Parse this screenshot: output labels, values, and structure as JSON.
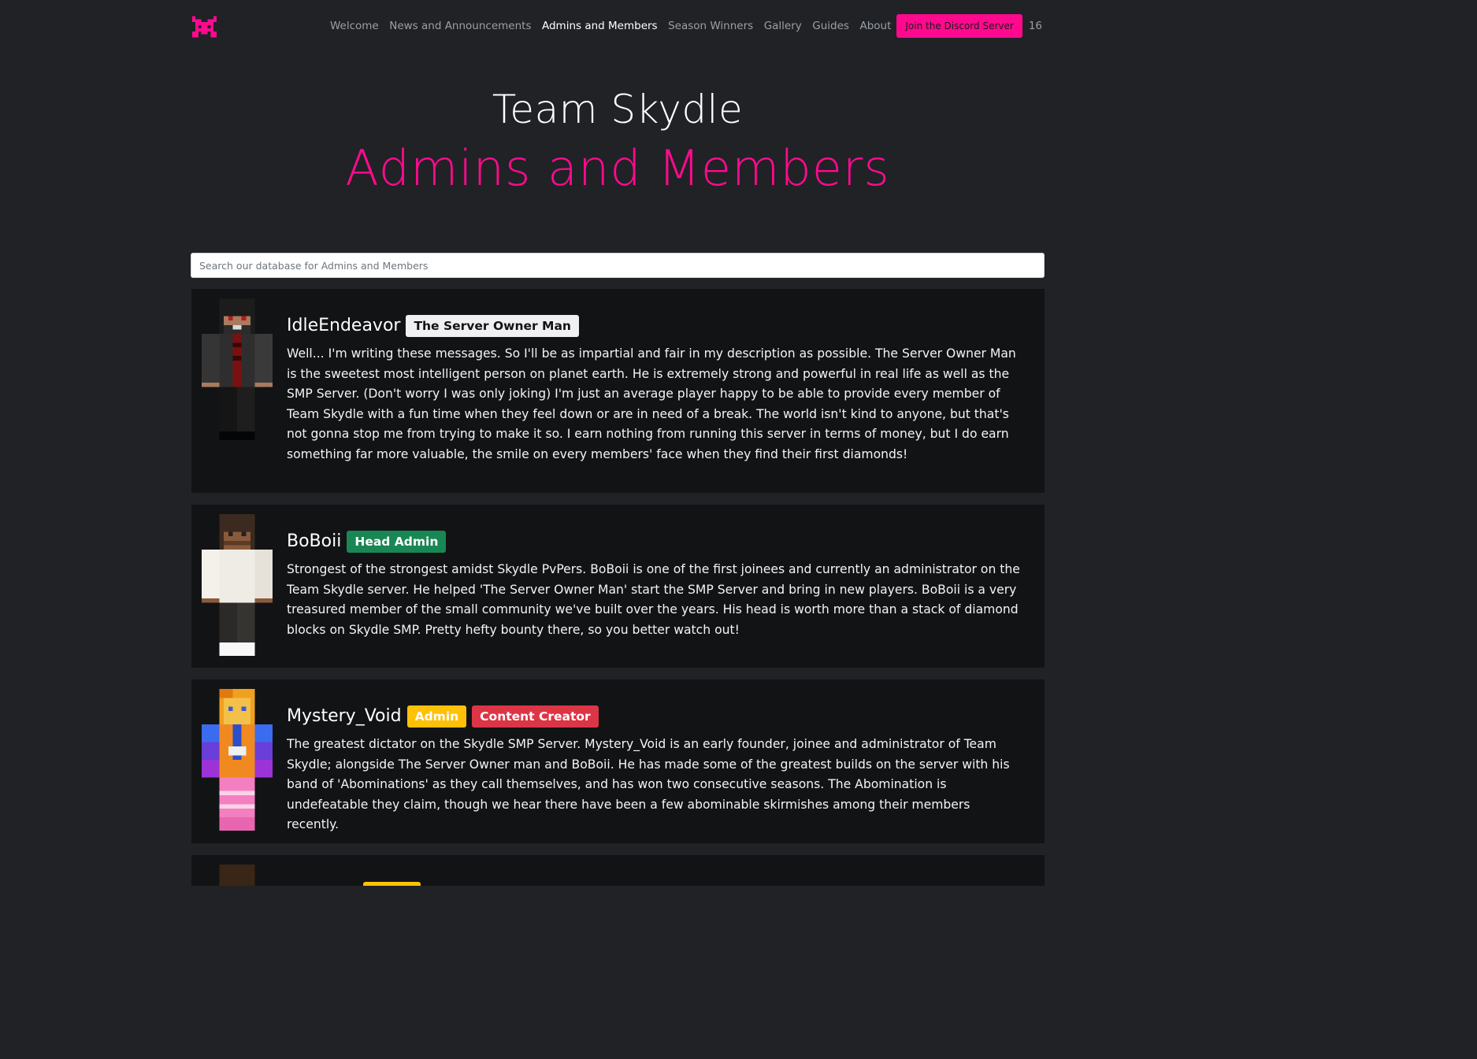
{
  "nav": {
    "links": [
      "Welcome",
      "News and Announcements",
      "Admins and Members",
      "Season Winners",
      "Gallery",
      "Guides",
      "About"
    ],
    "active_index": 2,
    "discord_label": "Join the Discord Server",
    "count": "16",
    "logo_icon": "pixel-bug-logo-icon"
  },
  "hero": {
    "title": "Team Skydle",
    "subtitle": "Admins and Members"
  },
  "search": {
    "placeholder": "Search our database for Admins and Members"
  },
  "members": [
    {
      "name": "IdleEndeavor",
      "badges": [
        "The Server Owner Man"
      ],
      "description": "Well... I'm writing these messages. So I'll be as impartial and fair in my description as possible. The Server Owner Man is the sweetest most intelligent person on planet earth. He is extremely strong and powerful in real life as well as the SMP Server. (Don't worry I was only joking) I'm just an average player happy to be able to provide every member of Team Skydle with a fun time when they feel down or are in need of a break. The world isn't kind to anyone, but that's not gonna stop me from trying to make it so. I earn nothing from running this server in terms of money, but I do earn something far more valuable, the smile on every members' face when they find their first diamonds!"
    },
    {
      "name": "BoBoii",
      "badges": [
        "Head Admin"
      ],
      "description": "Strongest of the strongest amidst Skydle PvPers. BoBoii is one of the first joinees and currently an administrator on the Team Skydle server. He helped 'The Server Owner Man' start the SMP Server and bring in new players. BoBoii is a very treasured member of the small community we've built over the years. His head is worth more than a stack of diamond blocks on Skydle SMP. Pretty hefty bounty there, so you better watch out!"
    },
    {
      "name": "Mystery_Void",
      "badges": [
        "Admin",
        "Content Creator"
      ],
      "description": "The greatest dictator on the Skydle SMP Server. Mystery_Void is an early founder, joinee and administrator of Team Skydle; alongside The Server Owner man and BoBoii. He has made some of the greatest builds on the server with his band of 'Abominations' as they call themselves, and has won two consecutive seasons. The Abomination is undefeatable they claim, though we hear there have been a few abominable skirmishes among their members recently."
    }
  ],
  "colors": {
    "accent": "#ff0a8e",
    "background": "#202226",
    "card": "#121314",
    "head_admin_badge": "#198754",
    "admin_badge": "#ffc107",
    "content_creator_badge": "#dc3545"
  }
}
